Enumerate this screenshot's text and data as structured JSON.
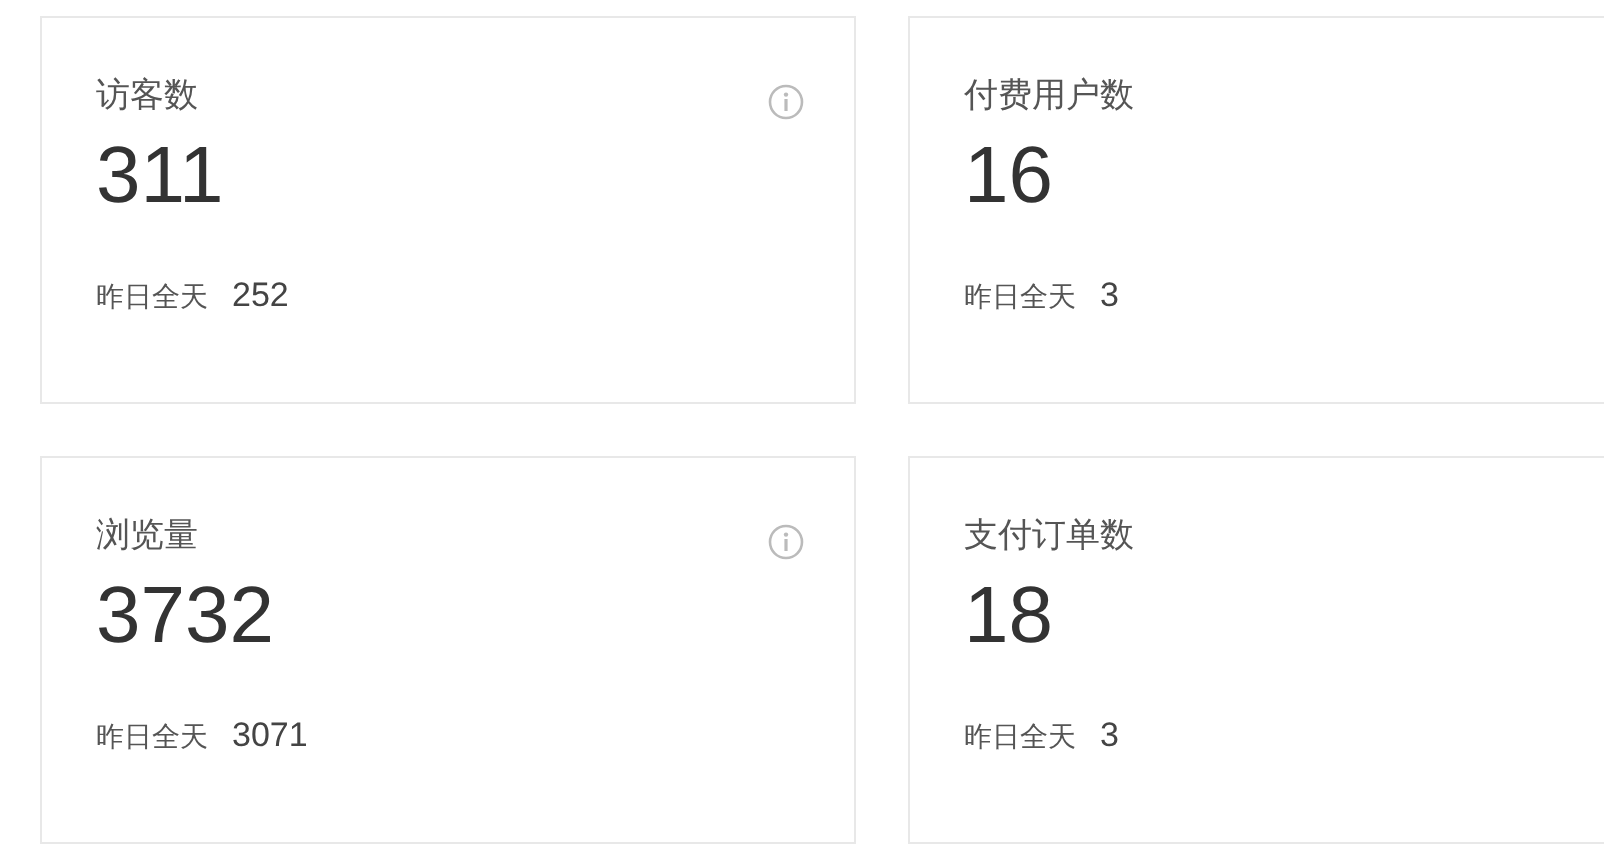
{
  "cards": [
    {
      "title": "访客数",
      "value": "311",
      "compare_label": "昨日全天",
      "compare_value": "252",
      "info": true
    },
    {
      "title": "付费用户数",
      "value": "16",
      "compare_label": "昨日全天",
      "compare_value": "3"
    },
    {
      "title": "浏览量",
      "value": "3732",
      "compare_label": "昨日全天",
      "compare_value": "3071",
      "info": true
    },
    {
      "title": "支付订单数",
      "value": "18",
      "compare_label": "昨日全天",
      "compare_value": "3"
    }
  ]
}
